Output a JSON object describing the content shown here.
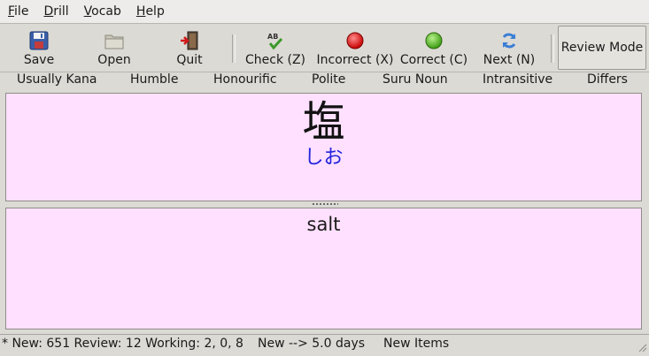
{
  "menu": {
    "items": [
      {
        "mnemonic": "F",
        "rest": "ile"
      },
      {
        "mnemonic": "D",
        "rest": "rill"
      },
      {
        "mnemonic": "V",
        "rest": "ocab"
      },
      {
        "mnemonic": "H",
        "rest": "elp"
      }
    ]
  },
  "toolbar": {
    "save": "Save",
    "open": "Open",
    "quit": "Quit",
    "check": "Check (Z)",
    "incorrect": "Incorrect (X)",
    "correct": "Correct (C)",
    "next": "Next (N)",
    "review_mode": "Review Mode",
    "icons": {
      "save": "floppy-disk-icon",
      "open": "folder-icon",
      "quit": "exit-door-icon",
      "check": "spellcheck-icon",
      "incorrect": "red-circle-icon",
      "correct": "green-circle-icon",
      "next": "refresh-icon"
    },
    "colors": {
      "incorrect": "#e01010",
      "correct": "#4cbf1a",
      "next": "#3a7fd5"
    }
  },
  "tags": [
    "Usually Kana",
    "Humble",
    "Honourific",
    "Polite",
    "Suru Noun",
    "Intransitive",
    "Differs"
  ],
  "card": {
    "kanji": "塩",
    "reading": "しお",
    "meaning": "salt",
    "background": "#ffe0ff",
    "reading_color": "#2222dd"
  },
  "status": {
    "counts": "* New: 651 Review: 12 Working: 2, 0, 8",
    "interval": "New --> 5.0 days",
    "mode": "New Items"
  }
}
